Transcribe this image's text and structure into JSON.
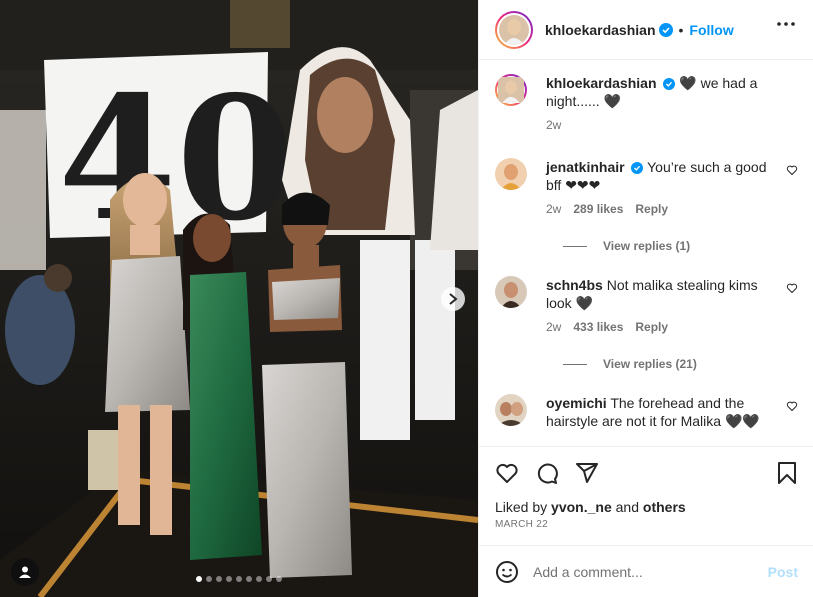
{
  "photo": {
    "sign_text": "40",
    "carousel": {
      "total": 9,
      "active": 0
    }
  },
  "header": {
    "username": "khloekardashian",
    "separator": "•",
    "follow_label": "Follow"
  },
  "caption": {
    "username": "khloekardashian",
    "text": "🖤 we had a night...... 🖤",
    "time": "2w"
  },
  "comments": [
    {
      "username": "jenatkinhair",
      "verified": true,
      "text": "You’re such a good bff ❤❤❤",
      "time": "2w",
      "likes": "289 likes",
      "reply": "Reply",
      "view_replies": "View replies (1)"
    },
    {
      "username": "schn4bs",
      "verified": false,
      "text": "Not malika stealing kims look 🖤",
      "time": "2w",
      "likes": "433 likes",
      "reply": "Reply",
      "view_replies": "View replies (21)"
    },
    {
      "username": "oyemichi",
      "verified": false,
      "text": "The forehead and the hairstyle are not it for Malika 🖤🖤"
    }
  ],
  "actions": {
    "liked_prefix": "Liked by",
    "liked_user": "yvon._ne",
    "liked_and": "and",
    "liked_others": "others",
    "date": "MARCH 22"
  },
  "add_comment": {
    "placeholder": "Add a comment...",
    "post_label": "Post"
  },
  "colors": {
    "accent": "#0095f6",
    "post_disabled": "#b2dffc",
    "muted": "#737373"
  },
  "icons": [
    "verified-icon",
    "more-icon",
    "heart-icon",
    "comment-icon",
    "share-icon",
    "save-icon",
    "emoji-icon",
    "chevron-right-icon",
    "user-tag-icon"
  ]
}
